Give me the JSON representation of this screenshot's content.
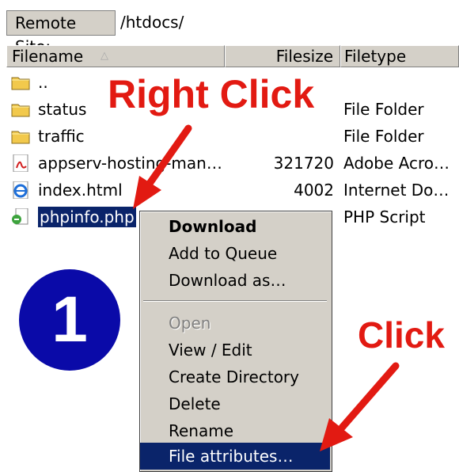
{
  "site_bar": {
    "label": "Remote Site:",
    "path": "/htdocs/"
  },
  "columns": {
    "filename": "Filename",
    "filesize": "Filesize",
    "filetype": "Filetype"
  },
  "files": [
    {
      "name": "..",
      "size": "",
      "type": "",
      "icon": "folder-icon"
    },
    {
      "name": "status",
      "size": "",
      "type": "File Folder",
      "icon": "folder-icon"
    },
    {
      "name": "traffic",
      "size": "",
      "type": "File Folder",
      "icon": "folder-icon"
    },
    {
      "name": "appserv-hosting-man…",
      "size": "321720",
      "type": "Adobe Acro…",
      "icon": "pdf-icon"
    },
    {
      "name": "index.html",
      "size": "4002",
      "type": "Internet Do…",
      "icon": "ie-html-icon"
    },
    {
      "name": "phpinfo.php",
      "size": "",
      "type": "PHP Script",
      "icon": "php-file-icon"
    }
  ],
  "context_menu": {
    "items": [
      {
        "label": "Download"
      },
      {
        "label": "Add to Queue"
      },
      {
        "label": "Download as…"
      },
      {
        "label": "Open"
      },
      {
        "label": "View / Edit"
      },
      {
        "label": "Create Directory"
      },
      {
        "label": "Delete"
      },
      {
        "label": "Rename"
      },
      {
        "label": "File attributes…"
      }
    ]
  },
  "annotations": {
    "right_click": "Right Click",
    "click": "Click",
    "step": "1"
  },
  "colors": {
    "annotation_red": "#e21a12",
    "selection_blue": "#0a246a",
    "step_circle": "#0a0aa8",
    "menu_bg": "#d4d0c8"
  }
}
